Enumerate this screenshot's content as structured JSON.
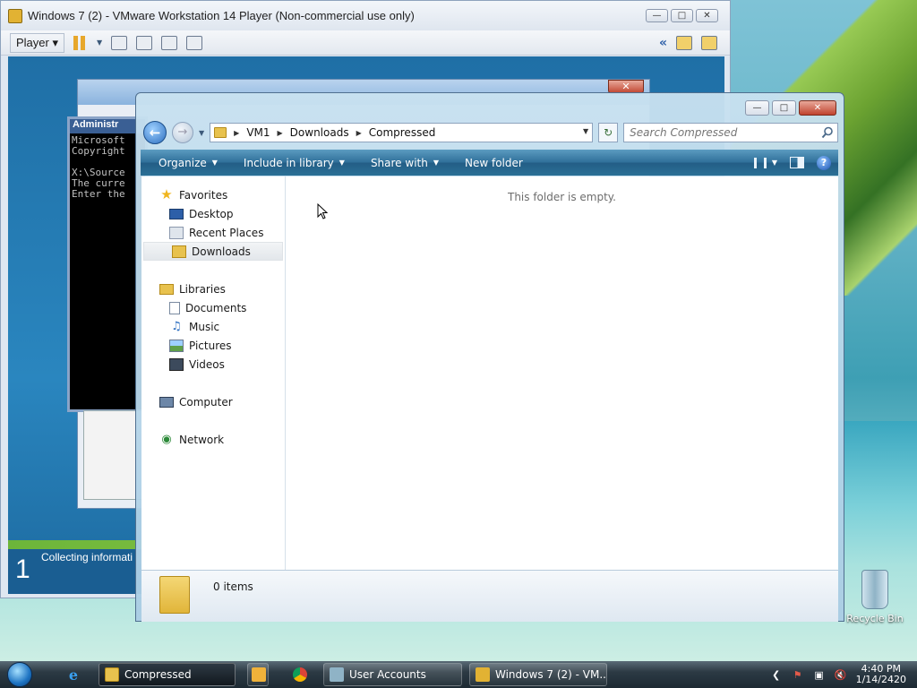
{
  "vmware": {
    "title": "Windows 7 (2) - VMware Workstation 14 Player (Non-commercial use only)",
    "player_menu": "Player",
    "guest": {
      "cmd_title": "Administr",
      "cmd_lines": "Microsoft\nCopyright\n\nX:\\Source\nThe curre\nEnter the",
      "install_step": "1",
      "install_status": "Collecting informati"
    }
  },
  "explorer": {
    "breadcrumb": [
      "VM1",
      "Downloads",
      "Compressed"
    ],
    "search_placeholder": "Search Compressed",
    "commands": {
      "organize": "Organize",
      "include": "Include in library",
      "share": "Share with",
      "new_folder": "New folder"
    },
    "nav": {
      "favorites": "Favorites",
      "desktop": "Desktop",
      "recent": "Recent Places",
      "downloads": "Downloads",
      "libraries": "Libraries",
      "documents": "Documents",
      "music": "Music",
      "pictures": "Pictures",
      "videos": "Videos",
      "computer": "Computer",
      "network": "Network"
    },
    "selected_nav": "Downloads",
    "empty_message": "This folder is empty.",
    "item_count": "0 items"
  },
  "desktop": {
    "recycle_bin": "Recycle Bin"
  },
  "taskbar": {
    "tasks": [
      "Compressed",
      "User Accounts",
      "Windows 7 (2) - VM..."
    ],
    "time": "4:40 PM",
    "date": "1/14/2420"
  },
  "colors": {
    "command_bar": "#2f6f99",
    "taskbar": "#1d2a33",
    "guest_background": "#2a86bf"
  }
}
